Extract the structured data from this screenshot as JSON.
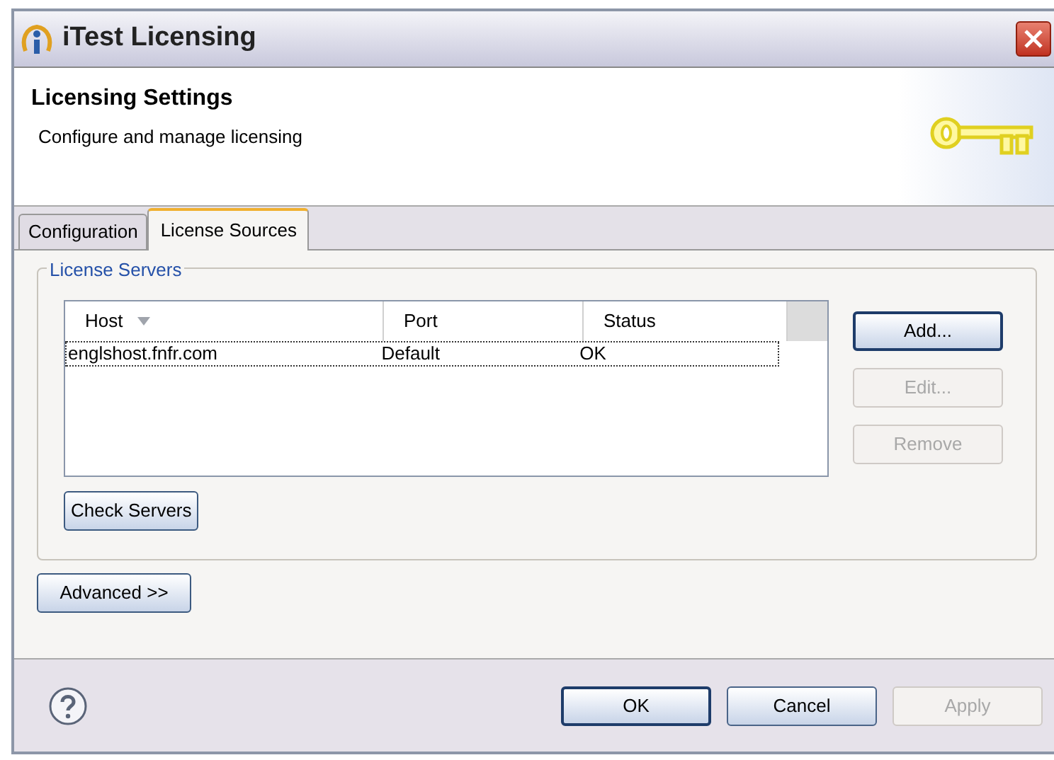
{
  "window": {
    "title": "iTest Licensing"
  },
  "header": {
    "title": "Licensing Settings",
    "subtitle": "Configure and manage licensing"
  },
  "tabs": [
    {
      "label": "Configuration",
      "selected": false
    },
    {
      "label": "License Sources",
      "selected": true
    }
  ],
  "license_servers": {
    "label": "License Servers",
    "columns": [
      {
        "label": "Host",
        "sorted": true
      },
      {
        "label": "Port",
        "sorted": false
      },
      {
        "label": "Status",
        "sorted": false
      }
    ],
    "rows": [
      {
        "cells": [
          "englshost.fnfr.com",
          "Default",
          "OK"
        ],
        "selected": true
      }
    ],
    "side_buttons": [
      {
        "label": "Add...",
        "disabled": false,
        "focused": true
      },
      {
        "label": "Edit...",
        "disabled": true,
        "focused": false
      },
      {
        "label": "Remove",
        "disabled": true,
        "focused": false
      }
    ],
    "check_button": "Check Servers"
  },
  "advanced_button": "Advanced >>",
  "footer_buttons": [
    {
      "label": "OK",
      "disabled": false,
      "focused": true
    },
    {
      "label": "Cancel",
      "disabled": false,
      "focused": false
    },
    {
      "label": "Apply",
      "disabled": true,
      "focused": false
    }
  ]
}
